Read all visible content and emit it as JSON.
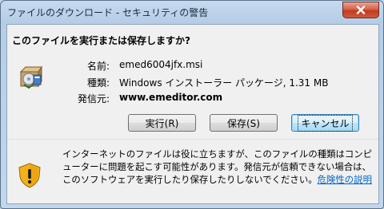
{
  "window": {
    "title": "ファイルのダウンロード - セキュリティの警告",
    "close_icon": "close-icon"
  },
  "dialog": {
    "question": "このファイルを実行または保存しますか?",
    "file_icon": "installer-package-icon",
    "fields": {
      "name_label": "名前:",
      "name_value": "emed6004jfx.msi",
      "type_label": "種類:",
      "type_value": "Windows インストーラー パッケージ, 1.31 MB",
      "from_label": "発信元:",
      "from_value": "www.emeditor.com"
    },
    "buttons": {
      "run_label": "実行(R)",
      "save_label": "保存(S)",
      "cancel_label": "キャンセル"
    }
  },
  "warning": {
    "icon": "security-shield-warning-icon",
    "text": "インターネットのファイルは役に立ちますが、このファイルの種類はコンピューターに問題を起こす可能性があります。発信元が信頼できない場合は、このソフトウェアを実行したり保存したりしないでください。",
    "link": "危険性の説明"
  }
}
